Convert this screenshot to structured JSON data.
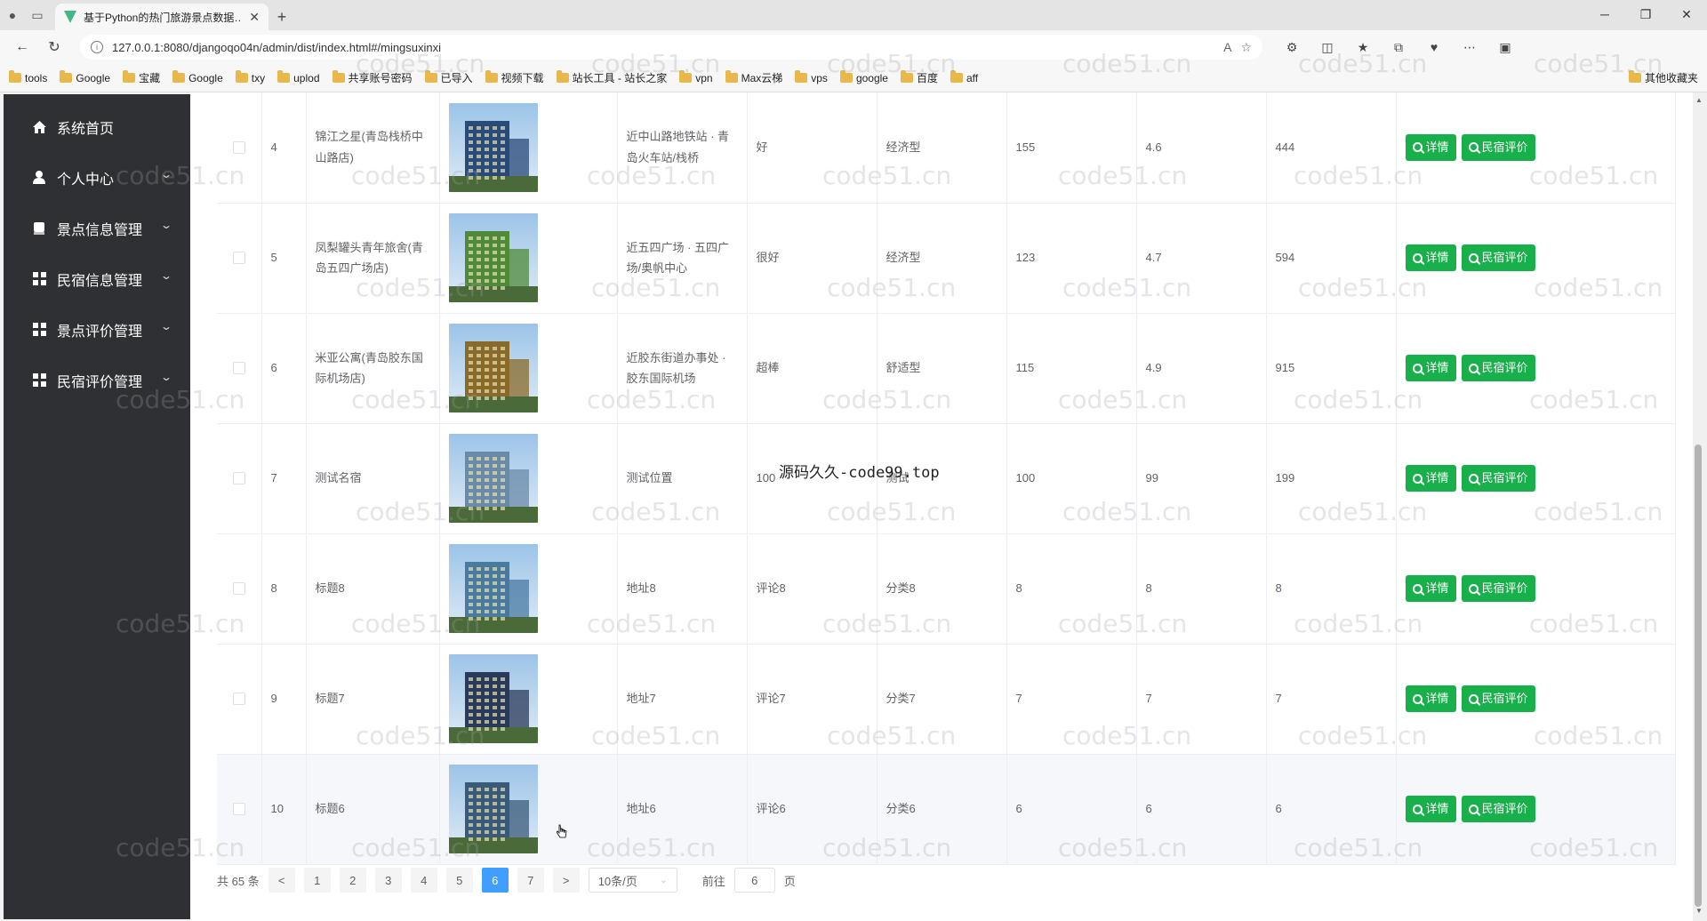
{
  "browser": {
    "tab_title": "基于Python的热门旅游景点数据…",
    "url": "127.0.0.1:8080/djangoqo04n/admin/dist/index.html#/mingsuxinxi",
    "bookmarks": [
      "tools",
      "Google",
      "宝藏",
      "Google",
      "txy",
      "uplod",
      "共享账号密码",
      "已导入",
      "视频下载",
      "站长工具 - 站长之家",
      "vpn",
      "Max云梯",
      "vps",
      "google",
      "百度",
      "aff"
    ],
    "bookmarks_other": "其他收藏夹"
  },
  "sidebar": {
    "items": [
      {
        "label": "系统首页",
        "icon": "home-icon",
        "has_submenu": false
      },
      {
        "label": "个人中心",
        "icon": "user-icon",
        "has_submenu": true
      },
      {
        "label": "景点信息管理",
        "icon": "book-icon",
        "has_submenu": true
      },
      {
        "label": "民宿信息管理",
        "icon": "grid-icon",
        "has_submenu": true
      },
      {
        "label": "景点评价管理",
        "icon": "grid-icon",
        "has_submenu": true
      },
      {
        "label": "民宿评价管理",
        "icon": "grid-icon",
        "has_submenu": true
      }
    ]
  },
  "table": {
    "detail_label": "详情",
    "review_label": "民宿评价",
    "rows": [
      {
        "index": "4",
        "name": "锦江之星(青岛栈桥中山路店)",
        "location": "近中山路地铁站 · 青岛火车站/栈桥",
        "review": "好",
        "category": "经济型",
        "price": "155",
        "score": "4.6",
        "count": "444",
        "img_color": "#2a4a7a"
      },
      {
        "index": "5",
        "name": "凤梨罐头青年旅舍(青岛五四广场店)",
        "location": "近五四广场 · 五四广场/奥帆中心",
        "review": "很好",
        "category": "经济型",
        "price": "123",
        "score": "4.7",
        "count": "594",
        "img_color": "#4f8a3a"
      },
      {
        "index": "6",
        "name": "米亚公寓(青岛胶东国际机场店)",
        "location": "近胶东街道办事处 · 胶东国际机场",
        "review": "超棒",
        "category": "舒适型",
        "price": "115",
        "score": "4.9",
        "count": "915",
        "img_color": "#8a6a2a"
      },
      {
        "index": "7",
        "name": "测试名宿",
        "location": "测试位置",
        "review": "100",
        "category": "测试",
        "price": "100",
        "score": "99",
        "count": "199",
        "img_color": "#6a8aa8"
      },
      {
        "index": "8",
        "name": "标题8",
        "location": "地址8",
        "review": "评论8",
        "category": "分类8",
        "price": "8",
        "score": "8",
        "count": "8",
        "img_color": "#4a7aa0"
      },
      {
        "index": "9",
        "name": "标题7",
        "location": "地址7",
        "review": "评论7",
        "category": "分类7",
        "price": "7",
        "score": "7",
        "count": "7",
        "img_color": "#2a3a5a"
      },
      {
        "index": "10",
        "name": "标题6",
        "location": "地址6",
        "review": "评论6",
        "category": "分类6",
        "price": "6",
        "score": "6",
        "count": "6",
        "img_color": "#3a5a7a"
      }
    ]
  },
  "pagination": {
    "total": "共 65 条",
    "prev": "<",
    "next": ">",
    "pages": [
      "1",
      "2",
      "3",
      "4",
      "5",
      "6",
      "7"
    ],
    "current": "6",
    "page_size": "10条/页",
    "goto_prefix": "前往",
    "goto_value": "6",
    "goto_suffix": "页"
  },
  "overlay_text": "源码久久-code99.top",
  "watermark": "code51.cn"
}
